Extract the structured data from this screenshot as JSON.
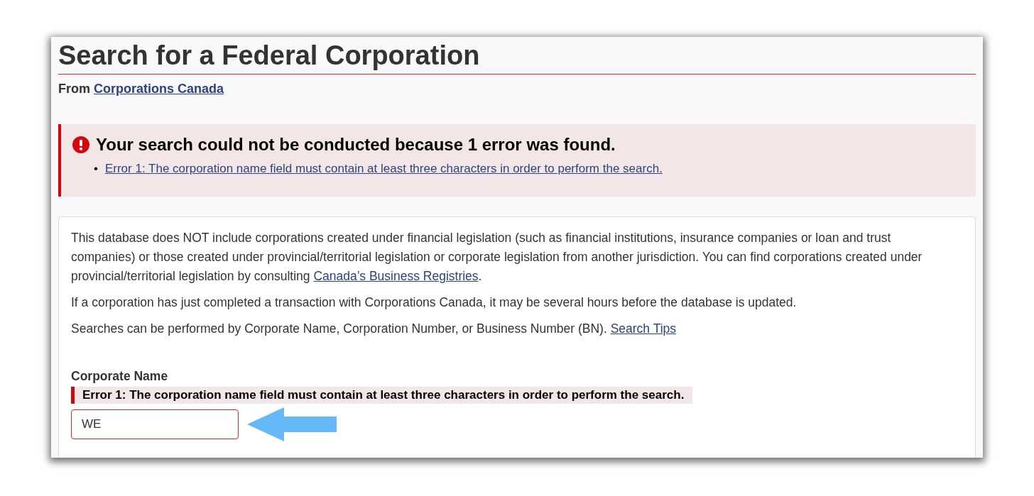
{
  "title": "Search for a Federal Corporation",
  "source": {
    "prefix": "From",
    "link": "Corporations Canada"
  },
  "error_summary": {
    "heading": "Your search could not be conducted because 1 error was found.",
    "bullet": "•",
    "errors": [
      "Error 1: The corporation name field must contain at least three characters in order to perform the search."
    ]
  },
  "info": [
    {
      "text": "This database does NOT include corporations created under financial legislation (such as financial institutions, insurance companies or loan and trust companies) or those created under provincial/territorial legislation or corporate legislation from another jurisdiction. You can find corporations created under provincial/territorial legislation by consulting",
      "link": "Canada’s Business Registries",
      "after": "."
    },
    {
      "text": "If a corporation has just completed a transaction with Corporations Canada, it may be several hours before the database is updated."
    },
    {
      "text": "Searches can be performed by Corporate Name, Corporation Number, or Business Number (BN).",
      "link": "Search Tips"
    }
  ],
  "field": {
    "label": "Corporate Name",
    "error": "Error 1: The corporation name field must contain at least three characters in order to perform the search.",
    "value": "WE",
    "invalid": true
  }
}
